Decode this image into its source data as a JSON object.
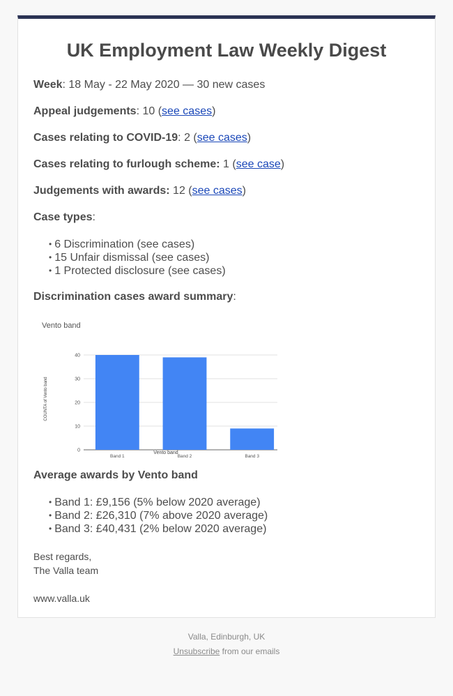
{
  "header": {
    "title": "UK Employment Law Weekly Digest",
    "accent_color": "#2b3354"
  },
  "stats": {
    "week": {
      "label": "Week",
      "value": ": 18 May - 22 May 2020 — 30 new cases"
    },
    "appeal": {
      "label": "Appeal judgements",
      "value": ": 10 (",
      "link": "see cases",
      "close": ")"
    },
    "covid": {
      "label": "Cases relating to COVID-19",
      "value": ": 2 (",
      "link": "see cases",
      "close": ")"
    },
    "furlough": {
      "label": "Cases relating to furlough scheme:",
      "value": " 1 (",
      "link": "see case",
      "close": ")"
    },
    "awards": {
      "label": "Judgements with awards:",
      "value": " 12 (",
      "link": "see cases",
      "close": ")"
    }
  },
  "case_types": {
    "label": "Case types",
    "suffix": ":",
    "items": [
      "6 Discrimination (see cases)",
      "15 Unfair dismissal (see cases)",
      "1 Protected disclosure (see cases)"
    ]
  },
  "award_summary": {
    "label": "Discrimination cases award summary",
    "suffix": ":"
  },
  "chart_data": {
    "type": "bar",
    "title": "Vento band",
    "xlabel": "Vento band",
    "ylabel": "COUNTA of Vento band",
    "categories": [
      "Band 1",
      "Band 2",
      "Band 3"
    ],
    "values": [
      40,
      39,
      9
    ],
    "ylim": [
      0,
      40
    ],
    "yticks": [
      0,
      10,
      20,
      30,
      40
    ],
    "grid": true,
    "bar_color": "#4285f4"
  },
  "averages": {
    "label": "Average awards by Vento band",
    "items": [
      "Band 1: £9,156 (5% below 2020 average)",
      "Band 2: £26,310 (7% above 2020 average)",
      "Band 3: £40,431 (2% below 2020 average)"
    ]
  },
  "signoff": {
    "greeting": "Best regards,",
    "team": "The Valla team",
    "website": "www.valla.uk"
  },
  "footer": {
    "address": "Valla, Edinburgh, UK",
    "unsubscribe": "Unsubscribe",
    "unsubscribe_suffix": " from our emails"
  },
  "link_color": "#1a47b8"
}
